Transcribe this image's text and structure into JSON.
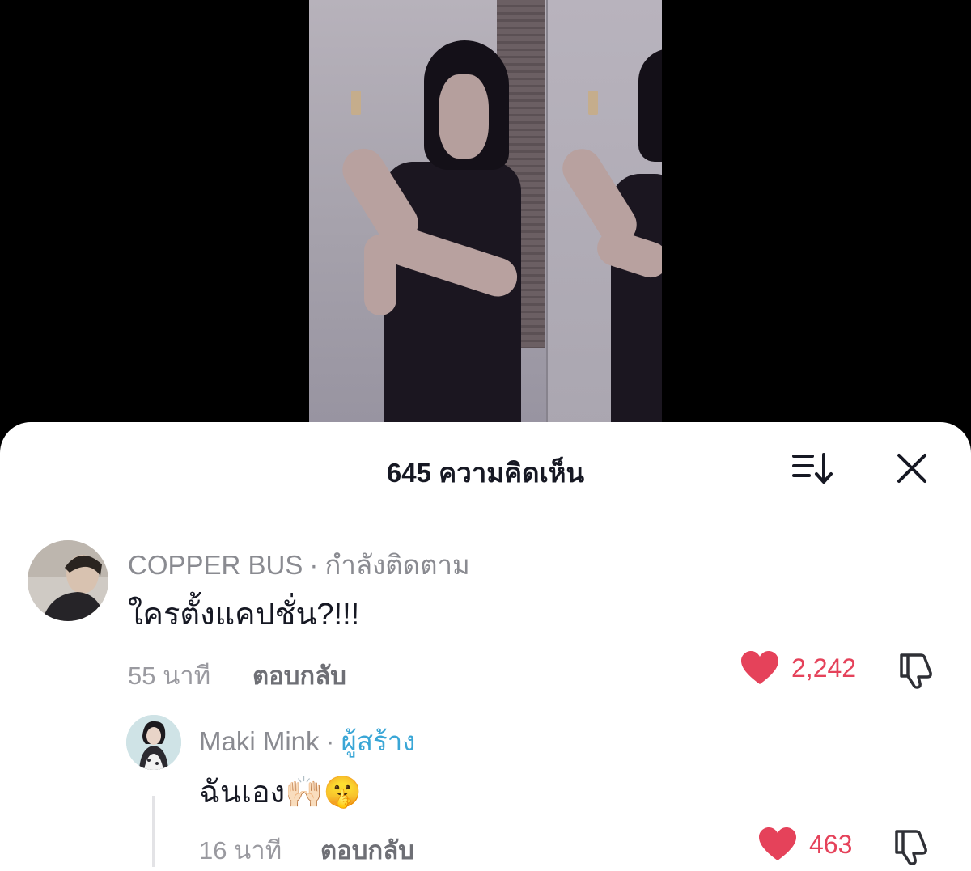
{
  "header": {
    "title": "645 ความคิดเห็น",
    "sort_icon": "sort-icon",
    "close_icon": "close-icon"
  },
  "comments": [
    {
      "username": "COPPER BUS",
      "badge": "กำลังติดตาม",
      "text": "ใครตั้งแคปชั่น?!!!",
      "time": "55 นาที",
      "reply_label": "ตอบกลับ",
      "likes": "2,242"
    },
    {
      "username": "Maki Mink",
      "badge": "ผู้สร้าง",
      "text": "ฉันเอง🙌🏻🤫",
      "time": "16 นาที",
      "reply_label": "ตอบกลับ",
      "likes": "463"
    }
  ],
  "colors": {
    "like": "#e5425a",
    "creator_badge": "#39a6d6",
    "title": "#161823"
  }
}
